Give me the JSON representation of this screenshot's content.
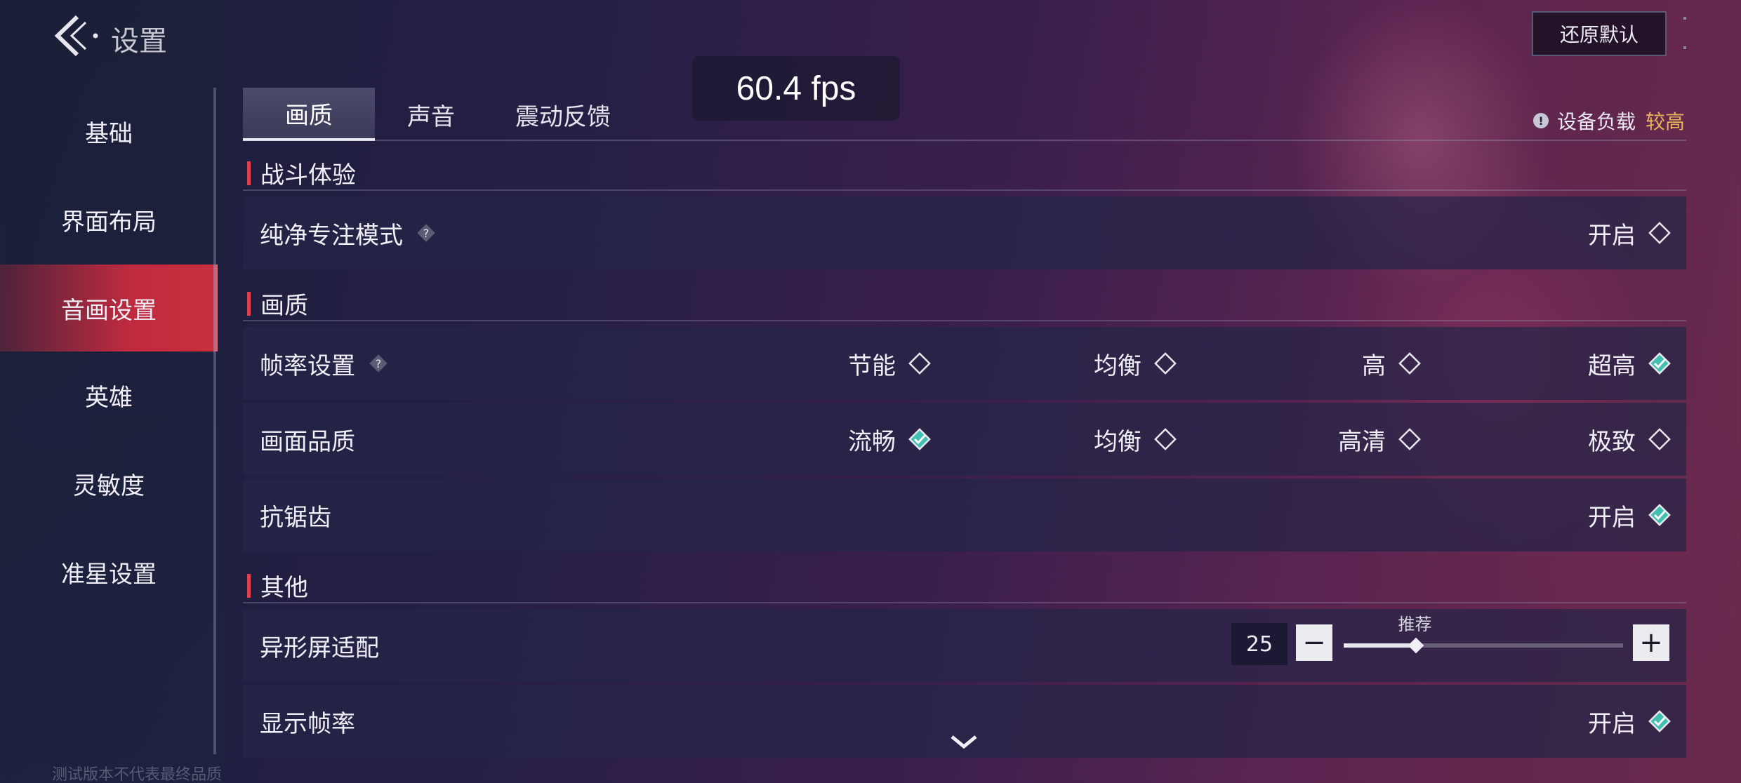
{
  "header": {
    "title": "设置",
    "reset_label": "还原默认",
    "fps": "60.4 fps"
  },
  "sidebar": {
    "items": [
      {
        "label": "基础",
        "active": false
      },
      {
        "label": "界面布局",
        "active": false
      },
      {
        "label": "音画设置",
        "active": true
      },
      {
        "label": "英雄",
        "active": false
      },
      {
        "label": "灵敏度",
        "active": false
      },
      {
        "label": "准星设置",
        "active": false
      }
    ],
    "footnote": "测试版本不代表最终品质"
  },
  "tabs": [
    {
      "label": "画质",
      "active": true
    },
    {
      "label": "声音",
      "active": false
    },
    {
      "label": "震动反馈",
      "active": false
    }
  ],
  "device_load": {
    "label": "设备负载",
    "value": "较高",
    "value_color": "#e8b25a"
  },
  "sections": {
    "battle": {
      "title": "战斗体验",
      "pure_focus": {
        "label": "纯净专注模式",
        "option": "开启",
        "selected": false
      }
    },
    "quality": {
      "title": "画质",
      "framerate": {
        "label": "帧率设置",
        "options": [
          "节能",
          "均衡",
          "高",
          "超高"
        ],
        "selected": "超高"
      },
      "picture": {
        "label": "画面品质",
        "options": [
          "流畅",
          "均衡",
          "高清",
          "极致"
        ],
        "selected": "流畅"
      },
      "antialias": {
        "label": "抗锯齿",
        "option": "开启",
        "selected": true
      }
    },
    "other": {
      "title": "其他",
      "notch": {
        "label": "异形屏适配",
        "value": "25",
        "slider_fraction": 0.26,
        "marker_label": "推荐",
        "minus": "−",
        "plus": "+"
      },
      "show_fps": {
        "label": "显示帧率",
        "option": "开启",
        "selected": true
      }
    }
  },
  "colors": {
    "accent_red": "#e0404e",
    "selected_teal": "#3fc0b0",
    "active_tab_bg": "#c8303e"
  }
}
